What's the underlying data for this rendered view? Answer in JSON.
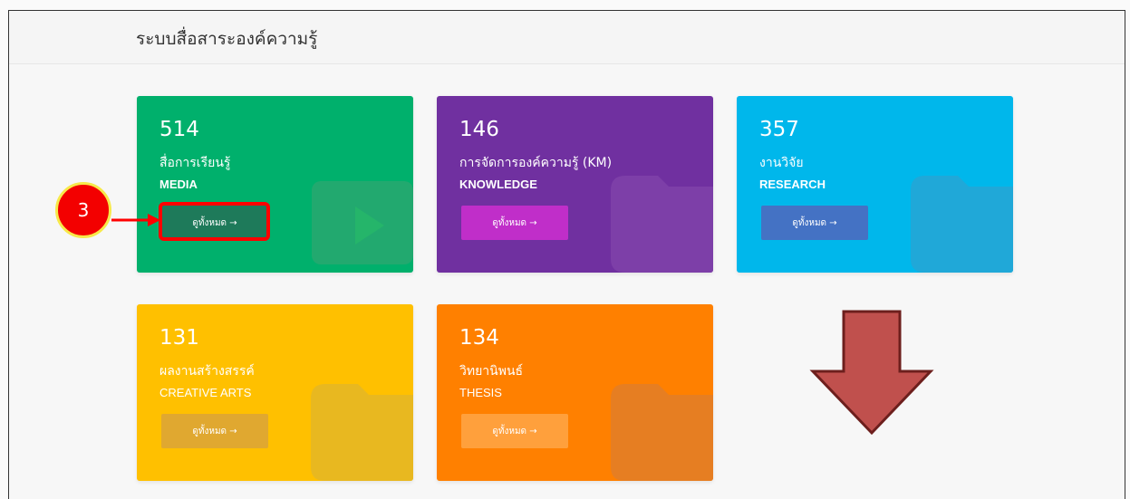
{
  "page": {
    "title": "ระบบสื่อสาระองค์ความรู้"
  },
  "cards": [
    {
      "count": "514",
      "thai": "สื่อการเรียนรู้",
      "eng": "MEDIA",
      "button": "ดูทั้งหมด →",
      "color": "#00b06c",
      "button_color": "#1e7a5a",
      "icon": "play-icon"
    },
    {
      "count": "146",
      "thai": "การจัดการองค์ความรู้ (KM)",
      "eng": "KNOWLEDGE",
      "button": "ดูทั้งหมด →",
      "color": "#7030a0",
      "button_color": "#c02ec9",
      "icon": "folder-icon"
    },
    {
      "count": "357",
      "thai": "งานวิจัย",
      "eng": "RESEARCH",
      "button": "ดูทั้งหมด →",
      "color": "#00b7eb",
      "button_color": "#4472c4",
      "icon": "folder-icon"
    },
    {
      "count": "131",
      "thai": "ผลงานสร้างสรรค์",
      "eng": "CREATIVE ARTS",
      "button": "ดูทั้งหมด →",
      "color": "#ffc000",
      "button_color": "#e0a830",
      "icon": "folder-icon"
    },
    {
      "count": "134",
      "thai": "วิทยานิพนธ์",
      "eng": "THESIS",
      "button": "ดูทั้งหมด →",
      "color": "#ff8000",
      "button_color": "#ffa03c",
      "icon": "folder-icon"
    }
  ],
  "annotation": {
    "step": "3",
    "circle_color": "#f30000",
    "arrow_color": "#c0504d"
  }
}
